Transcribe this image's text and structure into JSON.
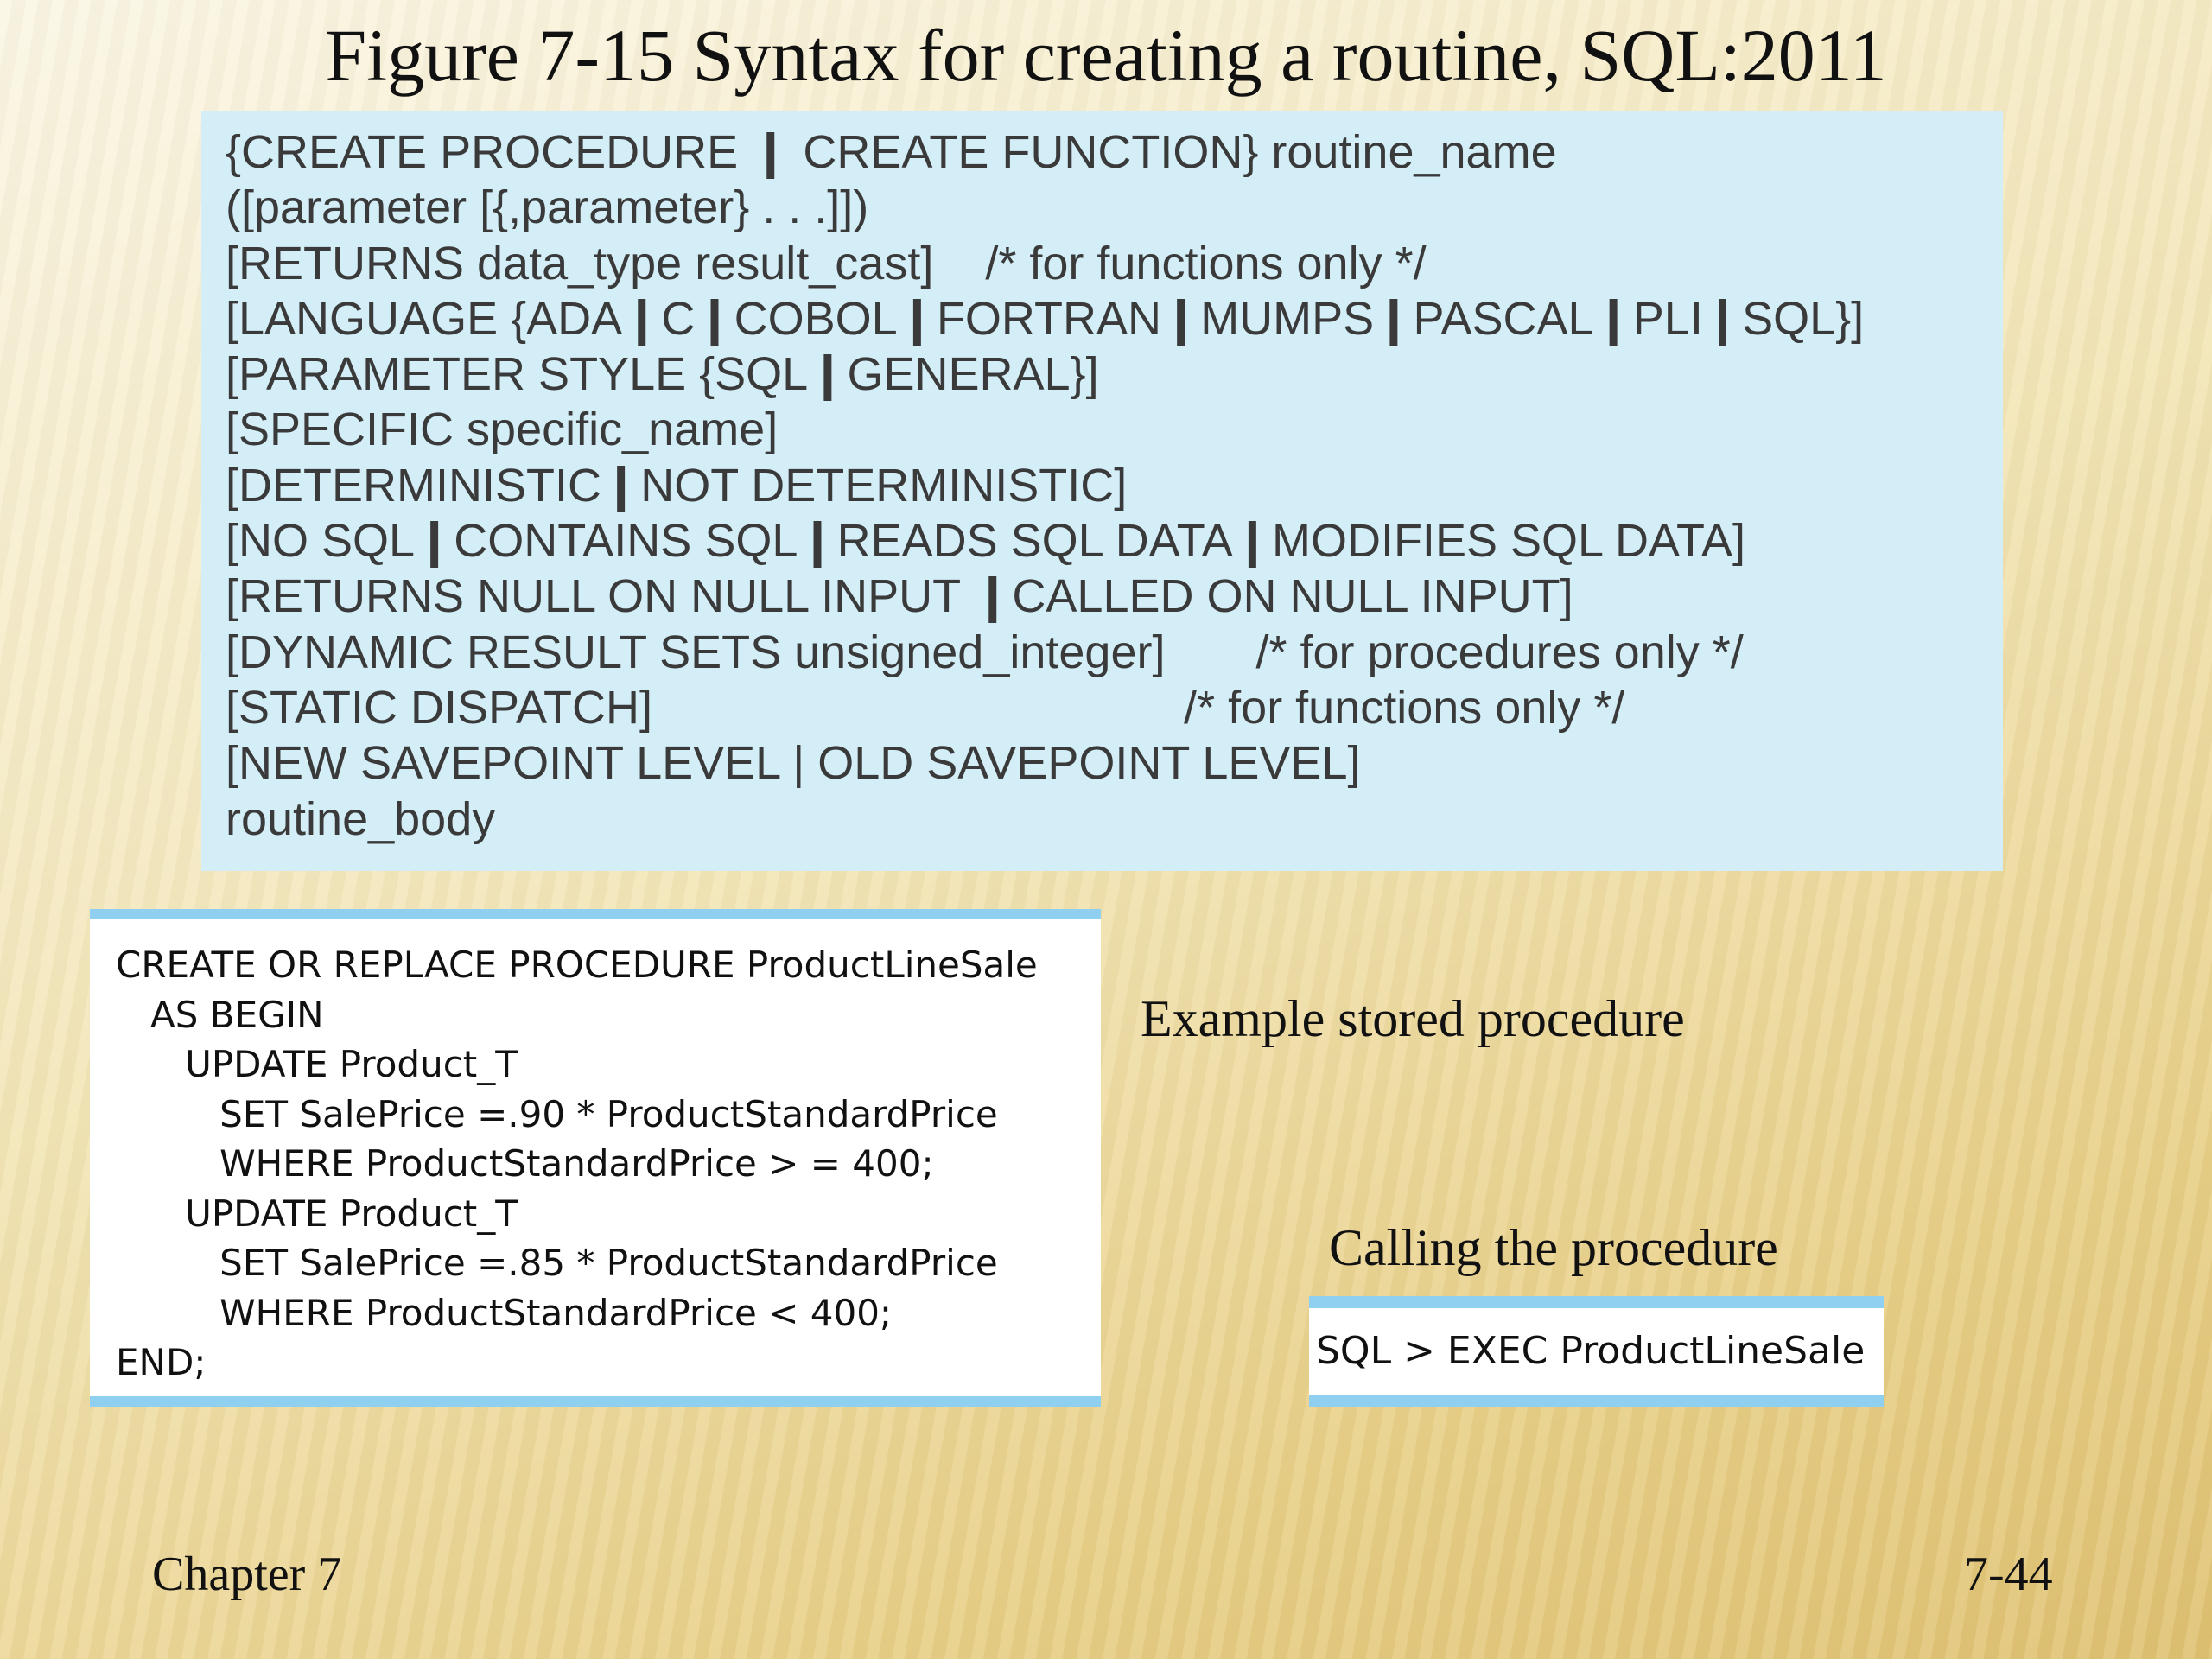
{
  "title": "Figure 7-15 Syntax for creating a routine, SQL:2011",
  "syntax_lines": [
    "{CREATE PROCEDURE ❙ CREATE FUNCTION} routine_name",
    "([parameter [{,parameter} . . .]])",
    "[RETURNS data_type result_cast]    /* for functions only */",
    "[LANGUAGE {ADA❙C❙COBOL❙FORTRAN❙MUMPS❙PASCAL❙PLI❙SQL}]",
    "[PARAMETER STYLE {SQL❙GENERAL}]",
    "[SPECIFIC specific_name]",
    "[DETERMINISTIC❙NOT DETERMINISTIC]",
    "[NO SQL❙CONTAINS SQL❙READS SQL DATA❙MODIFIES SQL DATA]",
    "[RETURNS NULL ON NULL INPUT ❙CALLED ON NULL INPUT]",
    "[DYNAMIC RESULT SETS unsigned_integer]       /* for procedures only */",
    "[STATIC DISPATCH]                                         /* for functions only */",
    "[NEW SAVEPOINT LEVEL | OLD SAVEPOINT LEVEL]",
    "routine_body"
  ],
  "procedure_code": [
    "CREATE OR REPLACE PROCEDURE ProductLineSale",
    "   AS BEGIN",
    "      UPDATE Product_T",
    "         SET SalePrice =.90 * ProductStandardPrice",
    "         WHERE ProductStandardPrice > = 400;",
    "      UPDATE Product_T",
    "         SET SalePrice =.85 * ProductStandardPrice",
    "         WHERE ProductStandardPrice < 400;",
    "END;"
  ],
  "example_caption": "Example stored procedure",
  "calling_caption": "Calling the procedure",
  "call_command": "SQL > EXEC ProductLineSale",
  "footer_left": "Chapter 7",
  "footer_right": "7-44"
}
